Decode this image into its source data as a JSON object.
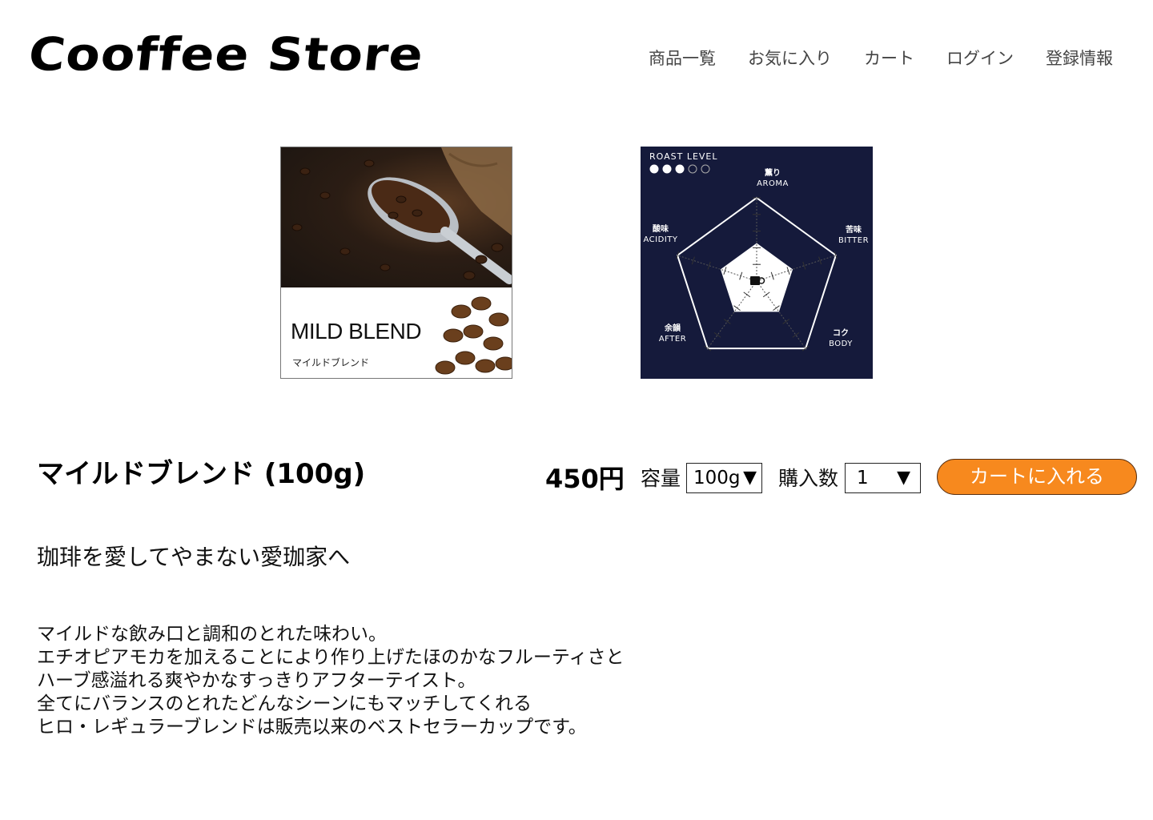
{
  "header": {
    "logo": "Cooffee Store",
    "nav": [
      "商品一覧",
      "お気に入り",
      "カート",
      "ログイン",
      "登録情報"
    ]
  },
  "product_image": {
    "title": "MILD BLEND",
    "subtitle": "マイルドブレンド"
  },
  "taste_chart": {
    "roast_label": "ROAST LEVEL",
    "roast_level": 3,
    "roast_max": 5,
    "axes": [
      {
        "jp": "薫り",
        "en": "AROMA"
      },
      {
        "jp": "苦味",
        "en": "BITTER"
      },
      {
        "jp": "コク",
        "en": "BODY"
      },
      {
        "jp": "余韻",
        "en": "AFTER"
      },
      {
        "jp": "酸味",
        "en": "ACIDITY"
      }
    ],
    "scale_max": 5,
    "values": [
      3,
      3,
      3,
      3,
      3
    ],
    "colors": {
      "background": "#151a3b",
      "fill": "#ffffff"
    }
  },
  "product": {
    "name": "マイルドブレンド (100g)",
    "price": "450円",
    "capacity_label": "容量",
    "capacity_value": "100g",
    "quantity_label": "購入数",
    "quantity_value": "1",
    "add_to_cart": "カートに入れる",
    "catchphrase": "珈琲を愛してやまない愛珈家へ",
    "description": [
      "マイルドな飲み口と調和のとれた味わい。",
      "エチオピアモカを加えることにより作り上げたほのかなフルーティさと",
      "ハーブ感溢れる爽やかなすっきりアフターテイスト。",
      "全てにバランスのとれたどんなシーンにもマッチしてくれる",
      "ヒロ・レギュラーブレンドは販売以来のベストセラーカップです。"
    ]
  },
  "colors": {
    "accent": "#f7891e",
    "text": "#111111"
  }
}
